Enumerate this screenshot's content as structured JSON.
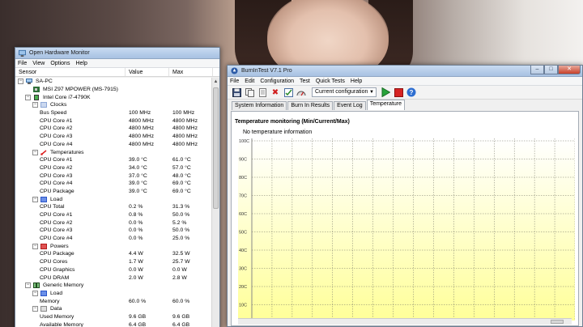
{
  "ohm": {
    "title": "Open Hardware Monitor",
    "menu": [
      "File",
      "View",
      "Options",
      "Help"
    ],
    "columns": {
      "sensor": "Sensor",
      "value": "Value",
      "max": "Max"
    },
    "rows": [
      {
        "indent": 0,
        "expander": "−",
        "icon": "computer-icon",
        "label": "SA-PC",
        "value": "",
        "max": ""
      },
      {
        "indent": 1,
        "expander": "",
        "icon": "motherboard-icon",
        "label": "MSI Z97 MPOWER (MS-7915)",
        "value": "",
        "max": ""
      },
      {
        "indent": 1,
        "expander": "−",
        "icon": "cpu-icon",
        "label": "Intel Core i7-4790K",
        "value": "",
        "max": ""
      },
      {
        "indent": 2,
        "expander": "−",
        "icon": "clock-icon",
        "label": "Clocks",
        "value": "",
        "max": ""
      },
      {
        "indent": 3,
        "expander": "",
        "icon": "",
        "label": "Bus Speed",
        "value": "100 MHz",
        "max": "100 MHz"
      },
      {
        "indent": 3,
        "expander": "",
        "icon": "",
        "label": "CPU Core #1",
        "value": "4800 MHz",
        "max": "4800 MHz"
      },
      {
        "indent": 3,
        "expander": "",
        "icon": "",
        "label": "CPU Core #2",
        "value": "4800 MHz",
        "max": "4800 MHz"
      },
      {
        "indent": 3,
        "expander": "",
        "icon": "",
        "label": "CPU Core #3",
        "value": "4800 MHz",
        "max": "4800 MHz"
      },
      {
        "indent": 3,
        "expander": "",
        "icon": "",
        "label": "CPU Core #4",
        "value": "4800 MHz",
        "max": "4800 MHz"
      },
      {
        "indent": 2,
        "expander": "−",
        "icon": "thermometer-icon",
        "label": "Temperatures",
        "value": "",
        "max": ""
      },
      {
        "indent": 3,
        "expander": "",
        "icon": "",
        "label": "CPU Core #1",
        "value": "39.0 °C",
        "max": "61.0 °C"
      },
      {
        "indent": 3,
        "expander": "",
        "icon": "",
        "label": "CPU Core #2",
        "value": "34.0 °C",
        "max": "57.0 °C"
      },
      {
        "indent": 3,
        "expander": "",
        "icon": "",
        "label": "CPU Core #3",
        "value": "37.0 °C",
        "max": "48.0 °C"
      },
      {
        "indent": 3,
        "expander": "",
        "icon": "",
        "label": "CPU Core #4",
        "value": "39.0 °C",
        "max": "69.0 °C"
      },
      {
        "indent": 3,
        "expander": "",
        "icon": "",
        "label": "CPU Package",
        "value": "39.0 °C",
        "max": "69.0 °C"
      },
      {
        "indent": 2,
        "expander": "−",
        "icon": "load-icon",
        "label": "Load",
        "value": "",
        "max": ""
      },
      {
        "indent": 3,
        "expander": "",
        "icon": "",
        "label": "CPU Total",
        "value": "0.2 %",
        "max": "31.3 %"
      },
      {
        "indent": 3,
        "expander": "",
        "icon": "",
        "label": "CPU Core #1",
        "value": "0.8 %",
        "max": "50.0 %"
      },
      {
        "indent": 3,
        "expander": "",
        "icon": "",
        "label": "CPU Core #2",
        "value": "0.0 %",
        "max": "5.2 %"
      },
      {
        "indent": 3,
        "expander": "",
        "icon": "",
        "label": "CPU Core #3",
        "value": "0.0 %",
        "max": "50.0 %"
      },
      {
        "indent": 3,
        "expander": "",
        "icon": "",
        "label": "CPU Core #4",
        "value": "0.0 %",
        "max": "25.0 %"
      },
      {
        "indent": 2,
        "expander": "−",
        "icon": "power-icon",
        "label": "Powers",
        "value": "",
        "max": ""
      },
      {
        "indent": 3,
        "expander": "",
        "icon": "",
        "label": "CPU Package",
        "value": "4.4 W",
        "max": "32.5 W"
      },
      {
        "indent": 3,
        "expander": "",
        "icon": "",
        "label": "CPU Cores",
        "value": "1.7 W",
        "max": "25.7 W"
      },
      {
        "indent": 3,
        "expander": "",
        "icon": "",
        "label": "CPU Graphics",
        "value": "0.0 W",
        "max": "0.0 W"
      },
      {
        "indent": 3,
        "expander": "",
        "icon": "",
        "label": "CPU DRAM",
        "value": "2.0 W",
        "max": "2.8 W"
      },
      {
        "indent": 1,
        "expander": "−",
        "icon": "memory-icon",
        "label": "Generic Memory",
        "value": "",
        "max": ""
      },
      {
        "indent": 2,
        "expander": "−",
        "icon": "load-icon",
        "label": "Load",
        "value": "",
        "max": ""
      },
      {
        "indent": 3,
        "expander": "",
        "icon": "",
        "label": "Memory",
        "value": "60.0 %",
        "max": "60.0 %"
      },
      {
        "indent": 2,
        "expander": "−",
        "icon": "data-icon",
        "label": "Data",
        "value": "",
        "max": ""
      },
      {
        "indent": 3,
        "expander": "",
        "icon": "",
        "label": "Used Memory",
        "value": "9.6 GB",
        "max": "9.6 GB"
      },
      {
        "indent": 3,
        "expander": "",
        "icon": "",
        "label": "Available Memory",
        "value": "6.4 GB",
        "max": "6.4 GB"
      }
    ]
  },
  "bit": {
    "title": "BurnInTest V7.1 Pro",
    "menu": [
      "File",
      "Edit",
      "Configuration",
      "Test",
      "Quick Tests",
      "Help"
    ],
    "config_value": "Current configuration",
    "tabs": [
      "System Information",
      "Burn In Results",
      "Event Log",
      "Temperature"
    ],
    "active_tab": 3,
    "panel_title": "Temperature monitoring  (Min/Current/Max)",
    "panel_note": "No temperature information",
    "colors": {
      "chart_fill_top": "#ffffff",
      "chart_fill_bottom": "#ffff99",
      "grid": "#7a7a6a"
    }
  },
  "chart_data": {
    "type": "line",
    "series": [],
    "yticks": [
      "100C",
      "90C",
      "80C",
      "70C",
      "60C",
      "50C",
      "40C",
      "30C",
      "20C",
      "10C"
    ],
    "ylim": [
      0,
      100
    ],
    "grid": true
  }
}
